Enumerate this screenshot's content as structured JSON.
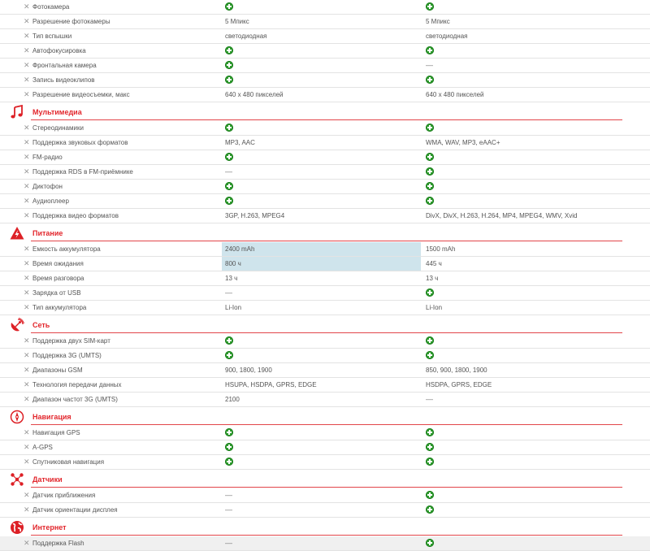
{
  "sections": [
    {
      "title": "",
      "icon": "camera-icon",
      "rows": [
        {
          "name": "Фотокамера",
          "c1": {
            "type": "plus"
          },
          "c2": {
            "type": "plus"
          }
        },
        {
          "name": "Разрешение фотокамеры",
          "c1": {
            "type": "text",
            "text": "5 Мпикс"
          },
          "c2": {
            "type": "text",
            "text": "5 Мпикс"
          }
        },
        {
          "name": "Тип вспышки",
          "c1": {
            "type": "text",
            "text": "светодиодная"
          },
          "c2": {
            "type": "text",
            "text": "светодиодная"
          }
        },
        {
          "name": " Автофокусировка",
          "c1": {
            "type": "plus"
          },
          "c2": {
            "type": "plus"
          }
        },
        {
          "name": "Фронтальная камера",
          "c1": {
            "type": "plus"
          },
          "c2": {
            "type": "dash",
            "text": "—"
          }
        },
        {
          "name": "Запись видеоклипов",
          "c1": {
            "type": "plus"
          },
          "c2": {
            "type": "plus"
          }
        },
        {
          "name": "Разрешение видеосъемки, макс",
          "c1": {
            "type": "text",
            "text": "640 x 480 пикселей"
          },
          "c2": {
            "type": "text",
            "text": "640 x 480 пикселей"
          }
        }
      ]
    },
    {
      "title": "Мультимедиа",
      "icon": "music-note-icon",
      "rows": [
        {
          "name": "Стереодинамики",
          "c1": {
            "type": "plus"
          },
          "c2": {
            "type": "plus"
          }
        },
        {
          "name": "Поддержка звуковых форматов",
          "c1": {
            "type": "text",
            "text": "MP3, AAC"
          },
          "c2": {
            "type": "text",
            "text": "WMA, WAV, MP3, eAAC+"
          }
        },
        {
          "name": "FM-радио",
          "c1": {
            "type": "plus"
          },
          "c2": {
            "type": "plus"
          }
        },
        {
          "name": "Поддержка RDS в FM-приёмнике",
          "c1": {
            "type": "dash",
            "text": "—"
          },
          "c2": {
            "type": "plus"
          }
        },
        {
          "name": "Диктофон",
          "c1": {
            "type": "plus"
          },
          "c2": {
            "type": "plus"
          }
        },
        {
          "name": "Аудиоплеер",
          "c1": {
            "type": "plus"
          },
          "c2": {
            "type": "plus"
          }
        },
        {
          "name": "Поддержка видео форматов",
          "c1": {
            "type": "text",
            "text": "3GP, H.263, MPEG4"
          },
          "c2": {
            "type": "text",
            "text": "DivX, DivX, H.263, H.264, MP4, MPEG4, WMV, Xvid"
          }
        }
      ]
    },
    {
      "title": "Питание",
      "icon": "warning-bolt-icon",
      "rows": [
        {
          "name": "Емкость аккумулятора",
          "c1": {
            "type": "text",
            "text": "2400 mAh",
            "hl": true
          },
          "c2": {
            "type": "text",
            "text": "1500 mAh"
          }
        },
        {
          "name": "Время ожидания",
          "c1": {
            "type": "text",
            "text": "800 ч",
            "hl": true
          },
          "c2": {
            "type": "text",
            "text": "445 ч"
          }
        },
        {
          "name": "Время разговора",
          "c1": {
            "type": "text",
            "text": "13 ч"
          },
          "c2": {
            "type": "text",
            "text": "13 ч"
          }
        },
        {
          "name": "Зарядка от USB",
          "c1": {
            "type": "dash",
            "text": "—"
          },
          "c2": {
            "type": "plus"
          }
        },
        {
          "name": "Тип аккумулятора",
          "c1": {
            "type": "text",
            "text": "Li-Ion"
          },
          "c2": {
            "type": "text",
            "text": "Li-Ion"
          }
        }
      ]
    },
    {
      "title": "Сеть",
      "icon": "satellite-dish-icon",
      "rows": [
        {
          "name": "Поддержка двух SIM-карт",
          "c1": {
            "type": "plus"
          },
          "c2": {
            "type": "plus"
          }
        },
        {
          "name": "Поддержка 3G (UMTS)",
          "c1": {
            "type": "plus"
          },
          "c2": {
            "type": "plus"
          }
        },
        {
          "name": "Диапазоны GSM",
          "c1": {
            "type": "text",
            "text": "900, 1800, 1900"
          },
          "c2": {
            "type": "text",
            "text": "850, 900, 1800, 1900"
          }
        },
        {
          "name": "Технология передачи данных",
          "c1": {
            "type": "text",
            "text": "HSUPA, HSDPA, GPRS, EDGE"
          },
          "c2": {
            "type": "text",
            "text": "HSDPA, GPRS, EDGE"
          }
        },
        {
          "name": "Диапазон частот 3G (UMTS)",
          "c1": {
            "type": "text",
            "text": "2100"
          },
          "c2": {
            "type": "dash",
            "text": "—"
          }
        }
      ]
    },
    {
      "title": "Навигация",
      "icon": "compass-icon",
      "rows": [
        {
          "name": "Навигация GPS",
          "c1": {
            "type": "plus"
          },
          "c2": {
            "type": "plus"
          }
        },
        {
          "name": "A-GPS",
          "c1": {
            "type": "plus"
          },
          "c2": {
            "type": "plus"
          }
        },
        {
          "name": "Спутниковая навигация",
          "c1": {
            "type": "plus"
          },
          "c2": {
            "type": "plus"
          }
        }
      ]
    },
    {
      "title": "Датчики",
      "icon": "sensor-icon",
      "rows": [
        {
          "name": "Датчик приближения",
          "c1": {
            "type": "dash",
            "text": "—"
          },
          "c2": {
            "type": "plus"
          }
        },
        {
          "name": "Датчик ориентации дисплея",
          "c1": {
            "type": "dash",
            "text": "—"
          },
          "c2": {
            "type": "plus"
          }
        }
      ]
    },
    {
      "title": "Интернет",
      "icon": "globe-icon",
      "rows": [
        {
          "name": "Поддержка Flash",
          "c1": {
            "type": "dash",
            "text": "—"
          },
          "c2": {
            "type": "plus"
          },
          "hover": true
        }
      ]
    }
  ],
  "remove_glyph": "✕"
}
